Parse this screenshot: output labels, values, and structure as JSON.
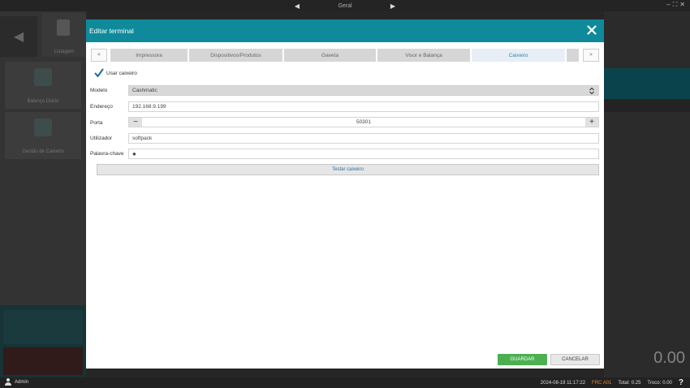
{
  "topbar": {
    "title": "Geral",
    "prev_icon": "triangle-left-icon",
    "next_icon": "triangle-right-icon",
    "window_controls": [
      "–",
      "⛶",
      "✕"
    ]
  },
  "background": {
    "listing_label": "Listagem",
    "tiles": [
      "Balanço Diário",
      "Gestão de Caixeiro"
    ],
    "total_display": "0.00"
  },
  "modal": {
    "title": "Editar terminal",
    "tabs": [
      {
        "label": "Impressora",
        "active": false
      },
      {
        "label": "Dispositivos/Produtos",
        "active": false
      },
      {
        "label": "Gaveta",
        "active": false
      },
      {
        "label": "Visor e Balança",
        "active": false
      },
      {
        "label": "Caixeiro",
        "active": true
      }
    ],
    "tab_prev": "<",
    "tab_next": ">",
    "use_cashier": {
      "label": "Usar caixeiro",
      "checked": true
    },
    "fields": {
      "modelo": {
        "label": "Modelo",
        "value": "Cashmatic"
      },
      "endereco": {
        "label": "Endereço",
        "value": "192.168.9.199"
      },
      "porta": {
        "label": "Porta",
        "value": "50301",
        "minus": "−",
        "plus": "+"
      },
      "utilizador": {
        "label": "Utilizador",
        "value": "softpack"
      },
      "palavra_chave": {
        "label": "Palavra-chave",
        "value": "●"
      }
    },
    "test_button": "Testar caixeiro",
    "save_button": "GUARDAR",
    "cancel_button": "CANCELAR",
    "colors": {
      "header": "#0e8a9b",
      "save": "#4cb050",
      "active_tab_text": "#2a88a8"
    }
  },
  "statusbar": {
    "user": "Admin",
    "datetime": "2024-08-19 11:17:22",
    "terminal": "FRC A01",
    "total_label": "Total:",
    "total_value": "0.25",
    "change_label": "Troco:",
    "change_value": "0.00",
    "help": "?"
  }
}
